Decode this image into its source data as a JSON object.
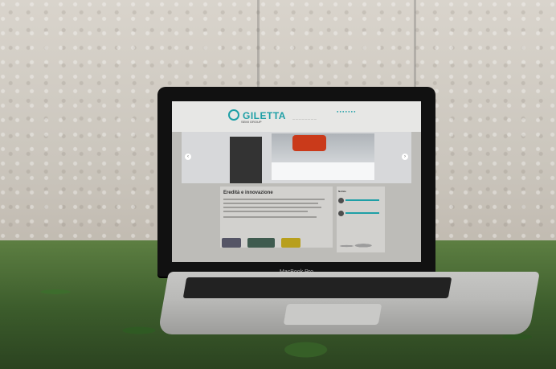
{
  "scene": {
    "brand": "GILETTA",
    "brand_subtext": "SEMI GROUP",
    "laptop_model": "MacBook Pro",
    "site": {
      "heading": "Eredità e innovazione",
      "sidebar_title": "Notizie",
      "slide_caption": "Titolo"
    }
  }
}
